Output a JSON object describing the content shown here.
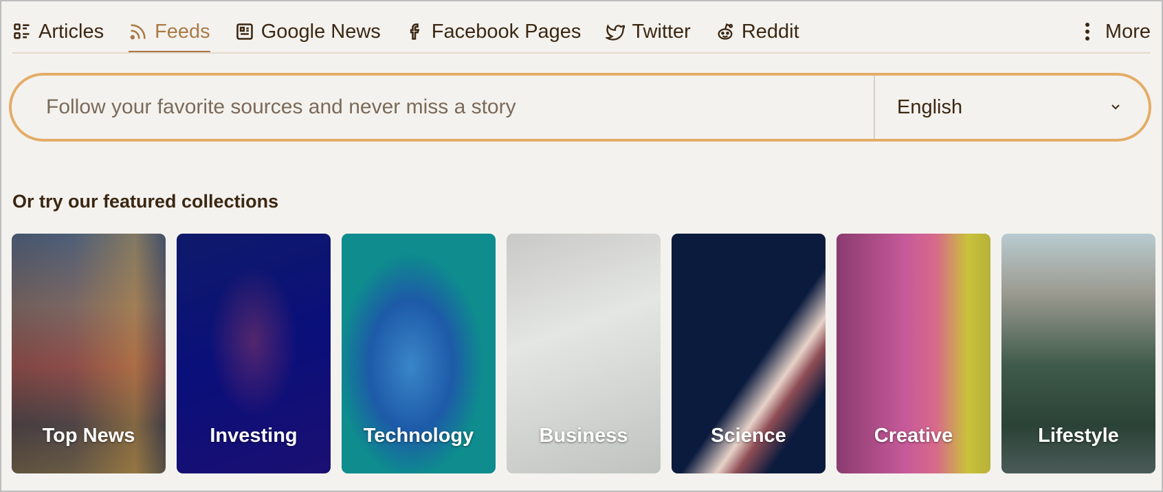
{
  "tabs": [
    {
      "label": "Articles",
      "icon": "articles-list-icon",
      "active": false
    },
    {
      "label": "Feeds",
      "icon": "rss-icon",
      "active": true
    },
    {
      "label": "Google News",
      "icon": "news-icon",
      "active": false
    },
    {
      "label": "Facebook Pages",
      "icon": "facebook-icon",
      "active": false
    },
    {
      "label": "Twitter",
      "icon": "twitter-icon",
      "active": false
    },
    {
      "label": "Reddit",
      "icon": "reddit-icon",
      "active": false
    }
  ],
  "more": {
    "label": "More",
    "icon": "more-vertical-icon"
  },
  "search": {
    "placeholder": "Follow your favorite sources and never miss a story",
    "language": "English"
  },
  "featured": {
    "heading": "Or try our featured collections",
    "collections": [
      {
        "label": "Top News"
      },
      {
        "label": "Investing"
      },
      {
        "label": "Technology"
      },
      {
        "label": "Business"
      },
      {
        "label": "Science"
      },
      {
        "label": "Creative"
      },
      {
        "label": "Lifestyle"
      }
    ]
  },
  "colors": {
    "accent": "#a97a45",
    "border": "#e3ad68",
    "text": "#3b2712",
    "background": "#f4f2ee"
  }
}
